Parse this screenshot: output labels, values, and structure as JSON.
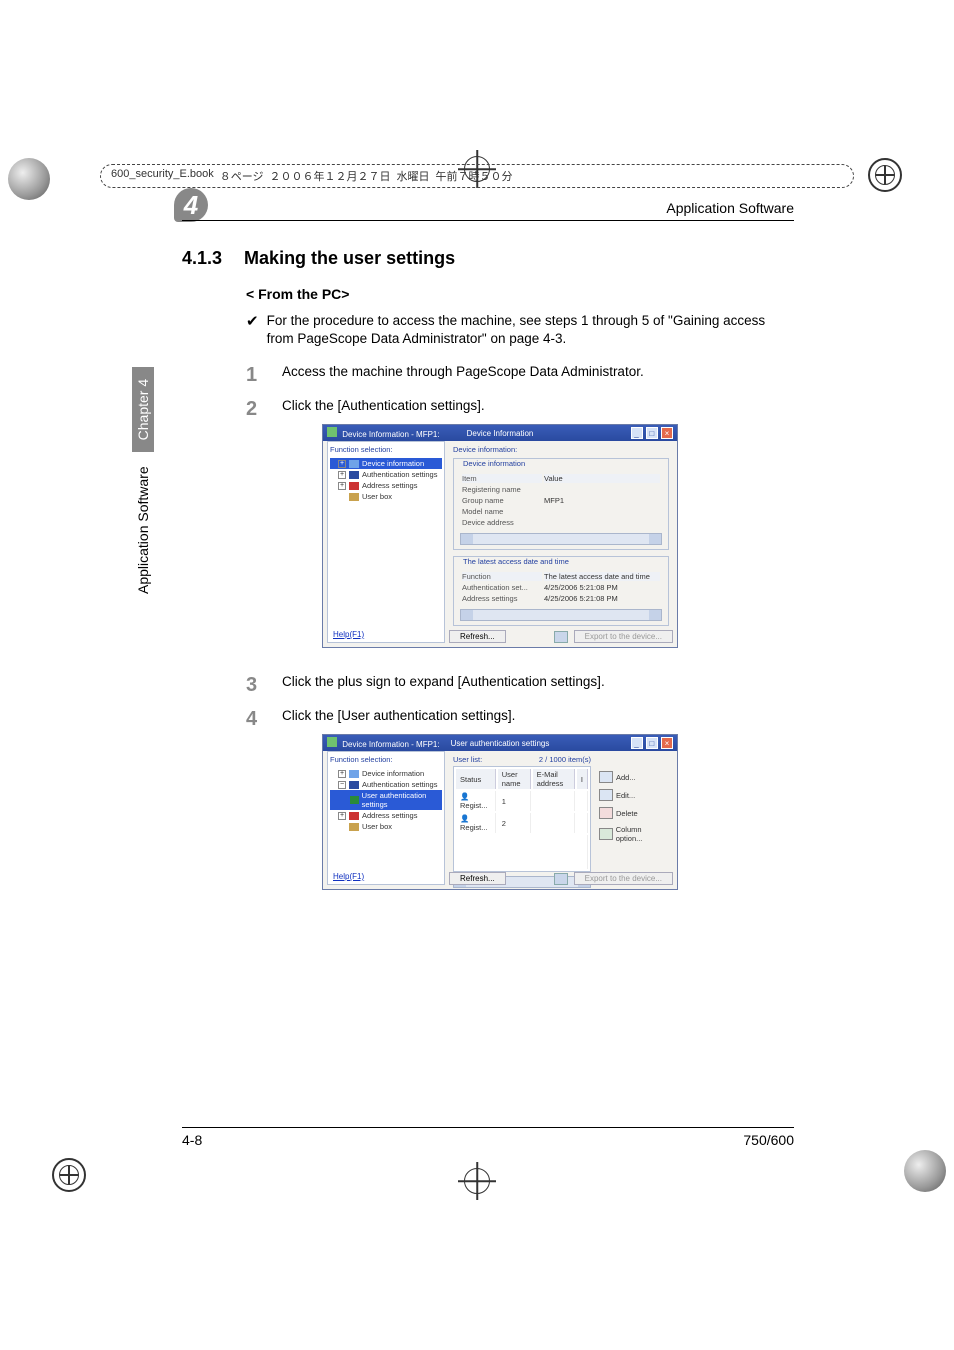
{
  "file_bar": {
    "filename": "600_security_E.book",
    "page_jp": "８ページ",
    "date_jp": "２００６年１２月２７日",
    "weekday_jp": "水曜日",
    "time_jp": "午前７時５０分"
  },
  "header": {
    "right": "Application Software",
    "chapter_number": "4"
  },
  "section": {
    "number": "4.1.3",
    "title": "Making the user settings"
  },
  "subheading": "< From the PC>",
  "intro": "For the procedure to access the machine, see steps 1 through 5 of \"Gaining access from PageScope Data Administrator\" on page 4-3.",
  "steps": {
    "s1": "Access the machine through PageScope Data Administrator.",
    "s2": "Click the [Authentication settings].",
    "s3": "Click the plus sign to expand [Authentication settings].",
    "s4": "Click the [User authentication settings]."
  },
  "screenshot1": {
    "window_title_left": "Device Information - MFP1:",
    "window_title_center": "Device Information",
    "left_panel_label": "Function selection:",
    "tree": {
      "device_info": "Device information",
      "auth_settings": "Authentication settings",
      "address_settings": "Address settings",
      "user_box": "User box"
    },
    "help": "Help(F1)",
    "right_label": "Device information:",
    "group1_title": "Device information",
    "info_items": {
      "item_h": "Item",
      "value_h": "Value",
      "registering_name": "Registering name",
      "group_name": "Group name",
      "group_name_v": "MFP1",
      "model_name": "Model name",
      "device_address": "Device address"
    },
    "group2_title": "The latest access date and time",
    "group2": {
      "func_h": "Function",
      "date_h": "The latest access date and time",
      "auth_row": "Authentication set...",
      "auth_date": "4/25/2006 5:21:08 PM",
      "addr_row": "Address settings",
      "addr_date": "4/25/2006 5:21:08 PM"
    },
    "buttons": {
      "refresh": "Refresh...",
      "export": "Export to the device..."
    }
  },
  "screenshot2": {
    "window_title_left": "Device Information - MFP1:",
    "window_title_center": "User authentication settings",
    "left_panel_label": "Function selection:",
    "tree": {
      "device_info": "Device information",
      "auth_settings": "Authentication settings",
      "user_auth": "User authentication settings",
      "address_settings": "Address settings",
      "user_box": "User box"
    },
    "help": "Help(F1)",
    "userlist_label": "User list:",
    "count": "2 / 1000 item(s)",
    "columns": {
      "status": "Status",
      "user": "User name",
      "email": "E-Mail address",
      "num": "I"
    },
    "rows": {
      "r1_status": "Regist...",
      "r1_user": "1",
      "r2_status": "Regist...",
      "r2_user": "2"
    },
    "side_buttons": {
      "add": "Add...",
      "edit": "Edit...",
      "delete": "Delete",
      "column": "Column option..."
    },
    "buttons": {
      "refresh": "Refresh...",
      "export": "Export to the device..."
    }
  },
  "side_tab": {
    "text": "Application Software",
    "chapter": "Chapter 4"
  },
  "footer": {
    "left": "4-8",
    "right": "750/600"
  }
}
